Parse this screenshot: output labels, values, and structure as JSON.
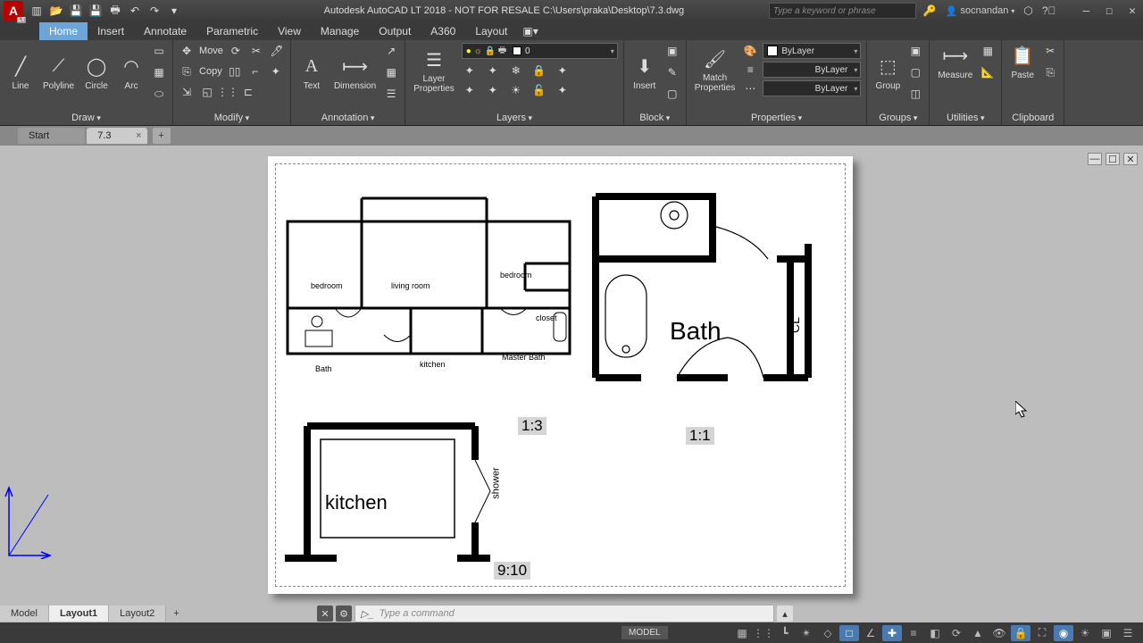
{
  "titlebar": {
    "app_title": "Autodesk AutoCAD LT 2018 - NOT FOR RESALE   C:\\Users\\praka\\Desktop\\7.3.dwg",
    "search_placeholder": "Type a keyword or phrase",
    "user": "socnandan"
  },
  "ribbon_tabs": [
    "Home",
    "Insert",
    "Annotate",
    "Parametric",
    "View",
    "Manage",
    "Output",
    "A360",
    "Layout"
  ],
  "active_ribbon_tab": "Home",
  "panels": {
    "draw": {
      "name": "Draw",
      "line": "Line",
      "polyline": "Polyline",
      "circle": "Circle",
      "arc": "Arc"
    },
    "modify": {
      "name": "Modify",
      "move": "Move",
      "copy": "Copy"
    },
    "annotation": {
      "name": "Annotation",
      "text": "Text",
      "dimension": "Dimension"
    },
    "layers": {
      "name": "Layers",
      "layerprops": "Layer\nProperties",
      "current_layer": "0"
    },
    "block": {
      "name": "Block",
      "insert": "Insert"
    },
    "properties": {
      "name": "Properties",
      "match": "Match\nProperties",
      "color": "ByLayer",
      "lw": "ByLayer",
      "lt": "ByLayer"
    },
    "groups": {
      "name": "Groups",
      "group": "Group"
    },
    "utilities": {
      "name": "Utilities",
      "measure": "Measure"
    },
    "clipboard": {
      "name": "Clipboard",
      "paste": "Paste"
    }
  },
  "doc_tabs": {
    "start": "Start",
    "file": "7.3"
  },
  "drawing": {
    "rooms": {
      "bedroom1": "bedroom",
      "living": "living room",
      "bedroom2": "bedroom",
      "closet": "closet",
      "kitchen_sm": "kitchen",
      "masterbath": "Master Bath",
      "bath_sm": "Bath",
      "bath_big": "Bath",
      "cl": "CL",
      "kitchen_big": "kitchen",
      "shower": "shower"
    },
    "scales": {
      "s13": "1:3",
      "s11": "1:1",
      "s910": "9:10"
    }
  },
  "cmdline": {
    "placeholder": "Type a command"
  },
  "layout_tabs": [
    "Model",
    "Layout1",
    "Layout2"
  ],
  "active_layout": "Layout1",
  "status_mode": "MODEL"
}
